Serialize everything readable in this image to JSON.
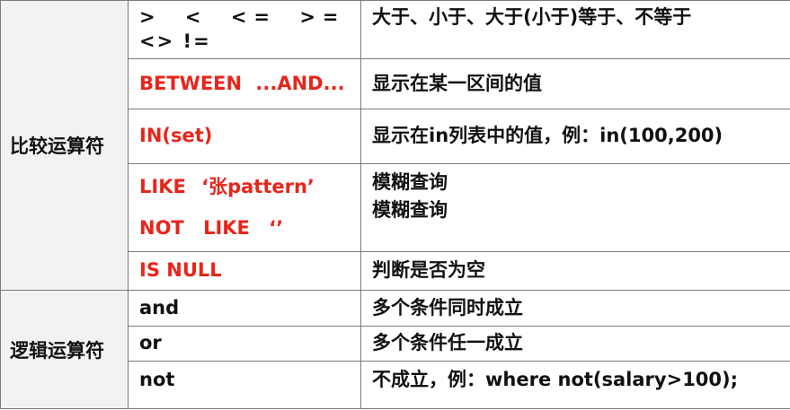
{
  "groups": [
    {
      "category": "比较运算符",
      "rows": [
        {
          "op_lines": [
            "> < <= >= =",
            "<> !="
          ],
          "op_red": false,
          "desc_lines": [
            "大于、小于、大于(小于)等于、不等于"
          ]
        },
        {
          "op_lines": [
            "BETWEEN ...AND..."
          ],
          "op_red": true,
          "desc_lines": [
            "显示在某一区间的值"
          ]
        },
        {
          "op_lines": [
            "IN(set)"
          ],
          "op_red": true,
          "desc_lines": [
            "显示在in列表中的值，例：in(100,200)"
          ]
        },
        {
          "op_lines": [
            "LIKE ‘张pattern’",
            "NOT LIKE ‘’"
          ],
          "op_red": true,
          "desc_lines": [
            "模糊查询",
            "模糊查询"
          ]
        },
        {
          "op_lines": [
            "IS NULL"
          ],
          "op_red": true,
          "desc_lines": [
            "判断是否为空"
          ]
        }
      ]
    },
    {
      "category": "逻辑运算符",
      "rows": [
        {
          "op_lines": [
            "and"
          ],
          "op_red": false,
          "desc_lines": [
            "多个条件同时成立"
          ]
        },
        {
          "op_lines": [
            "or"
          ],
          "op_red": false,
          "desc_lines": [
            "多个条件任一成立"
          ]
        },
        {
          "op_lines": [
            "not"
          ],
          "op_red": false,
          "desc_lines": [
            "不成立，例：where not(salary>100);"
          ]
        }
      ]
    }
  ],
  "colors": {
    "operator_red": "#e8251a",
    "text": "#111111",
    "border": "#7a7a7a",
    "category_bg": "#f2f2f2"
  }
}
